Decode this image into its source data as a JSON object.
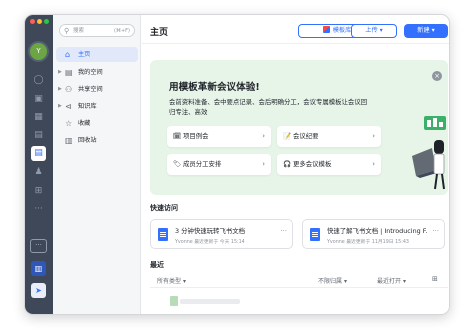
{
  "app": {
    "avatar_letter": "Y",
    "accent_color": "#3370ff",
    "banner_color": "#e7f5e9"
  },
  "rail": {
    "items": [
      "chat-icon",
      "video-icon",
      "calendar-icon",
      "grid-icon",
      "docs-icon",
      "contacts-icon",
      "apps-icon",
      "more-icon"
    ],
    "active": "docs-icon",
    "more_label": "···"
  },
  "search": {
    "placeholder": "搜索",
    "shortcut": "(⌘+F)"
  },
  "nav": {
    "items": [
      {
        "label": "主页",
        "icon": "home-icon",
        "active": true
      },
      {
        "label": "我的空间",
        "icon": "folder-icon",
        "expandable": true
      },
      {
        "label": "共享空间",
        "icon": "users-icon",
        "expandable": true
      },
      {
        "label": "知识库",
        "icon": "book-icon",
        "expandable": true
      },
      {
        "label": "收藏",
        "icon": "star-icon"
      },
      {
        "label": "回收站",
        "icon": "trash-icon"
      }
    ]
  },
  "header": {
    "title": "主页",
    "template_label": "模板库",
    "upload_label": "上传",
    "new_label": "新建"
  },
  "banner": {
    "title": "用模板革新会议体验!",
    "description": "会前资料准备、会中要点记录、会后明确分工，会议专属模板让会议回归专注、高效",
    "close": "×",
    "chips": [
      {
        "label": "项目例会",
        "icon": "🗓"
      },
      {
        "label": "会议纪要",
        "icon": "📝"
      },
      {
        "label": "成员分工安排",
        "icon": "🏷"
      },
      {
        "label": "更多会议模板",
        "icon": "🎧"
      }
    ]
  },
  "quick": {
    "title": "快速访问",
    "cards": [
      {
        "title": "3 分钟快速玩转飞书文档",
        "meta": "Yvonne 最近更新于 今天 15:14",
        "more": "···"
      },
      {
        "title": "快速了解飞书文档 | Introducing F...",
        "meta": "Yvonne 最近更新于 11月19日 15:43",
        "more": "···"
      }
    ]
  },
  "recent": {
    "title": "最近",
    "columns": [
      "所有类型",
      "不限归属",
      "最近打开"
    ]
  }
}
